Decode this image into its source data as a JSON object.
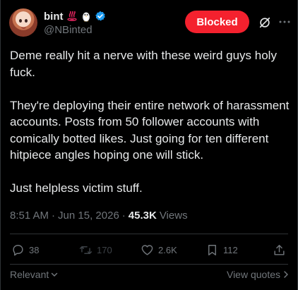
{
  "author": {
    "display_name": "bint",
    "badges": [
      "hot-springs-emoji",
      "penguin-emoji",
      "verified-badge-icon"
    ],
    "handle": "@NBinted"
  },
  "header": {
    "blocked_label": "Blocked",
    "icons": [
      "grok-icon",
      "more-icon"
    ]
  },
  "post": {
    "text": "Deme really hit a nerve with these weird guys holy fuck.\n\nThey're deploying their entire network of harassment accounts. Posts from 50 follower accounts with comically botted likes. Just going for ten different hitpiece angles hoping one will stick.\n\nJust helpless victim stuff.",
    "time": "8:51 AM",
    "sep1": "·",
    "date": "Jun 15, 2026",
    "sep2": "·",
    "views_count": "45.3K",
    "views_label": "Views"
  },
  "actions": {
    "replies": "38",
    "reposts": "170",
    "likes": "2.6K",
    "bookmarks": "112"
  },
  "footer": {
    "sort_label": "Relevant",
    "view_quotes_label": "View quotes"
  },
  "colors": {
    "background": "#000000",
    "text": "#e7e9ea",
    "muted": "#71767b",
    "blocked": "#f4212e",
    "verified": "#1d9bf0",
    "repost_muted": "#3d4247"
  }
}
